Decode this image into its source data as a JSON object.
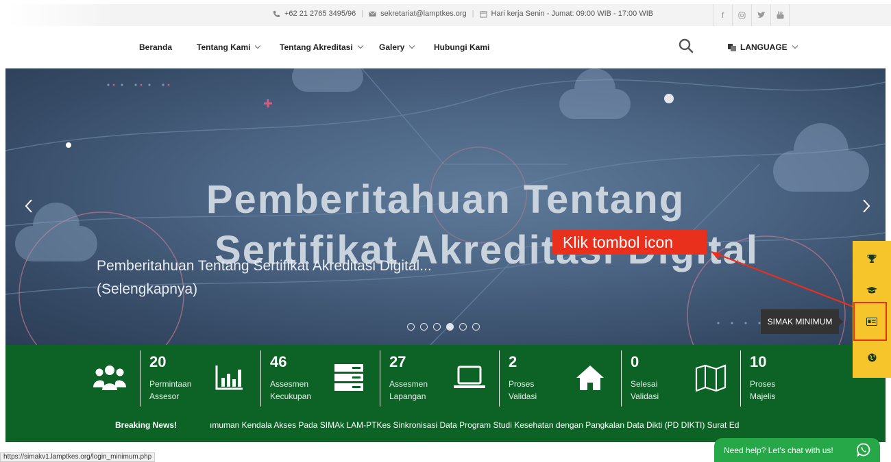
{
  "topbar": {
    "phone": "+62 21 2765 3495/96",
    "email": "sekretariat@lamptkes.org",
    "hours": "Hari kerja Senin - Jumat: 09:00 WIB - 17:00 WIB",
    "socials": [
      "facebook-icon",
      "instagram-icon",
      "twitter-icon",
      "youtube-icon"
    ]
  },
  "nav": {
    "items": [
      {
        "label": "Beranda",
        "dropdown": false
      },
      {
        "label": "Tentang Kami",
        "dropdown": true
      },
      {
        "label": "Tentang Akreditasi",
        "dropdown": true
      },
      {
        "label": "Galery",
        "dropdown": true
      },
      {
        "label": "Hubungi Kami",
        "dropdown": false
      }
    ],
    "language": "LANGUAGE"
  },
  "hero": {
    "title_line1": "Pemberitahuan Tentang",
    "title_line2": "Sertifikat Akreditasi Digital",
    "caption": "Pemberitahuan Tentang Sertifikat Akreditasi Digital... (Selengkapnya)",
    "slide_count": 6,
    "active_slide": 4
  },
  "annotation": {
    "text": "Klik tombol icon",
    "color": "#e8301d"
  },
  "stats": [
    {
      "value": "20",
      "line1": "Permintaan",
      "line2": "Assesor",
      "icon": "users-icon"
    },
    {
      "value": "46",
      "line1": "Assesmen",
      "line2": "Kecukupan",
      "icon": "bar-chart-icon"
    },
    {
      "value": "27",
      "line1": "Assesmen",
      "line2": "Lapangan",
      "icon": "server-icon"
    },
    {
      "value": "2",
      "line1": "Proses",
      "line2": "Validasi",
      "icon": "laptop-icon"
    },
    {
      "value": "0",
      "line1": "Selesai",
      "line2": "Validasi",
      "icon": "home-icon"
    },
    {
      "value": "10",
      "line1": "Proses",
      "line2": "Majelis",
      "icon": "map-icon"
    }
  ],
  "news": {
    "label": "Breaking News!",
    "ticker": "ımuman Kendala Akses Pada SIMAk LAM-PTKes   Sinkronisasi Data Program Studi Kesehatan dengan Pangkalan Data Dikti (PD DIKTI)   Surat Ed"
  },
  "sidebar": {
    "buttons": [
      "trophy-icon",
      "graduation-cap-icon",
      "id-card-icon",
      "globe-icon"
    ],
    "tooltip": "SIMAK MINIMUM"
  },
  "chat": {
    "label": "Need help? Let's chat with us!"
  },
  "status_url": "https://simakv1.lamptkes.org/login_minimum.php",
  "colors": {
    "green": "#0d6325",
    "yellow": "#f6c52c",
    "red": "#e8301d",
    "whatsapp": "#27a848"
  }
}
